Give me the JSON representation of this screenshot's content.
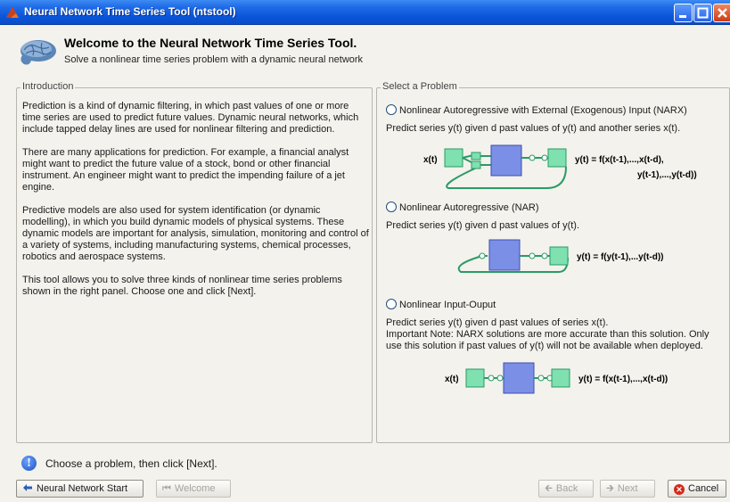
{
  "window": {
    "title": "Neural Network Time Series Tool (ntstool)",
    "minimize_icon": "minimize-icon",
    "maximize_icon": "maximize-icon",
    "close_icon": "close-icon"
  },
  "header": {
    "title": "Welcome to the Neural Network Time Series Tool.",
    "subtitle": "Solve a nonlinear time series problem with a dynamic neural network",
    "icon": "brain-icon"
  },
  "introduction": {
    "legend": "Introduction",
    "paragraphs": [
      "Prediction is a kind of dynamic filtering, in which past values of one or more time series are used to predict future values. Dynamic neural networks, which include tapped delay lines are used for nonlinear filtering and prediction.",
      "There are many applications for prediction. For example, a financial analyst might want to predict the future value of a stock, bond or other financial instrument. An engineer might want to predict the impending failure of a jet engine.",
      "Predictive models are also used for system identification (or dynamic modelling), in which you build dynamic models of physical systems. These dynamic models are important for analysis, simulation, monitoring and control of a variety of systems, including manufacturing systems, chemical processes, robotics and aerospace systems.",
      "This tool allows you to solve three kinds of nonlinear time series problems shown in the right panel. Choose one and click [Next]."
    ]
  },
  "problem": {
    "legend": "Select a Problem",
    "options": [
      {
        "label": "Nonlinear Autoregressive with External (Exogenous) Input (NARX)",
        "desc": "Predict series y(t) given d past values of y(t) and another series x(t).",
        "input_label": "x(t)",
        "eq1": "y(t) = f(x(t-1),...,x(t-d),",
        "eq2": "y(t-1),...,y(t-d))"
      },
      {
        "label": "Nonlinear Autoregressive (NAR)",
        "desc": "Predict series y(t) given d past values of y(t).",
        "eq1": "y(t) = f(y(t-1),...y(t-d))"
      },
      {
        "label": "Nonlinear Input-Ouput",
        "desc": "Predict series y(t) given d past values of series x(t).",
        "note": "Important Note: NARX solutions are more accurate than this solution. Only use this solution if past values of y(t) will not be available when deployed.",
        "input_label": "x(t)",
        "eq1": "y(t) = f(x(t-1),...,x(t-d))"
      }
    ]
  },
  "status": {
    "icon": "info-icon",
    "text": "Choose a problem, then click [Next]."
  },
  "buttons": {
    "start": "Neural Network Start",
    "welcome": "Welcome",
    "back": "Back",
    "next": "Next",
    "cancel": "Cancel"
  },
  "colors": {
    "titlebar": "#0a55d8",
    "node_green": "#7fe0b0",
    "node_blue": "#7c8fe6",
    "wire": "#2a9a66"
  }
}
